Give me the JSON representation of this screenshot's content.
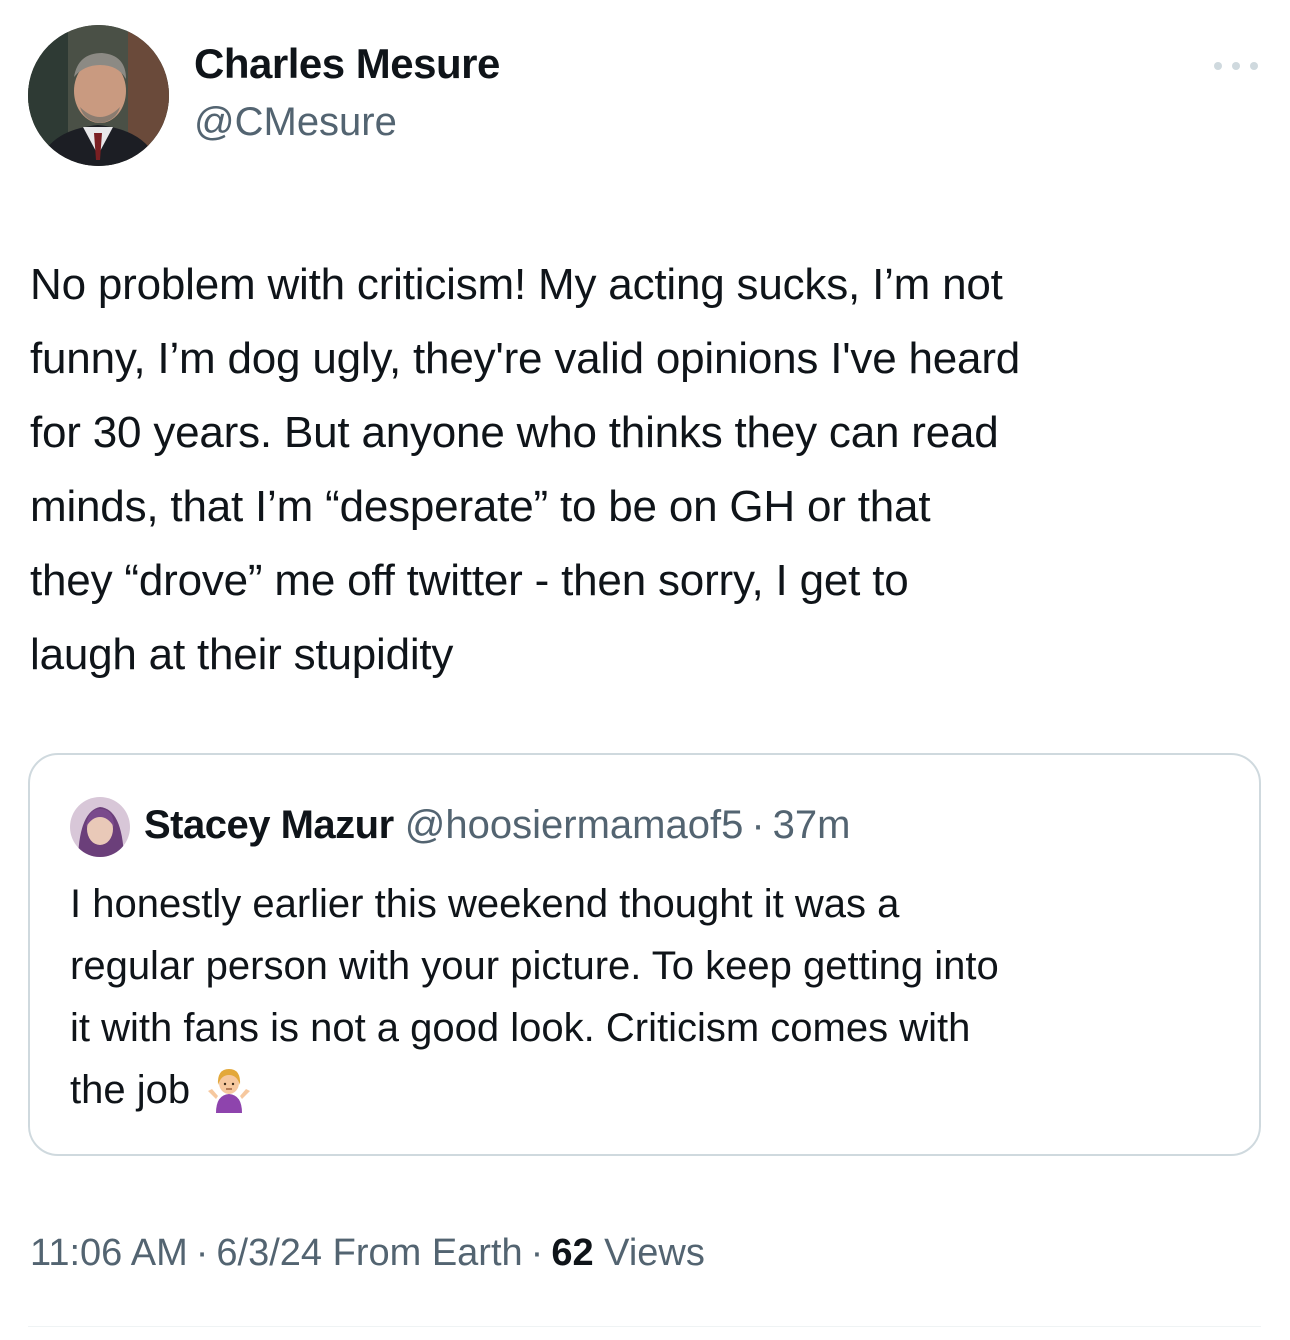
{
  "author": {
    "display_name": "Charles Mesure",
    "handle": "@CMesure"
  },
  "more_icon": "ellipsis-icon",
  "tweet": {
    "lines": [
      "No problem with criticism! My acting sucks, I’m not",
      "funny, I’m dog ugly, they're valid opinions I've heard",
      "for 30 years. But anyone who thinks they can read",
      "minds, that I’m “desperate” to be on GH or that",
      "they “drove” me off twitter - then sorry, I get to",
      "laugh at their stupidity"
    ]
  },
  "quote": {
    "display_name": "Stacey Mazur",
    "handle": "@hoosiermamaof5",
    "separator": "·",
    "time": "37m",
    "lines": [
      "I honestly earlier this weekend thought it was a",
      "regular person with your picture. To keep getting into",
      "it with fans is not a good look. Criticism comes with",
      "the job"
    ],
    "emoji": "person-shrugging-emoji"
  },
  "footer": {
    "time": "11:06 AM",
    "separator": "·",
    "date": "6/3/24",
    "source": "From Earth",
    "views_count": "62",
    "views_label": "Views"
  },
  "colors": {
    "text": "#0f1419",
    "secondary": "#536471",
    "border": "#cfd9de"
  }
}
